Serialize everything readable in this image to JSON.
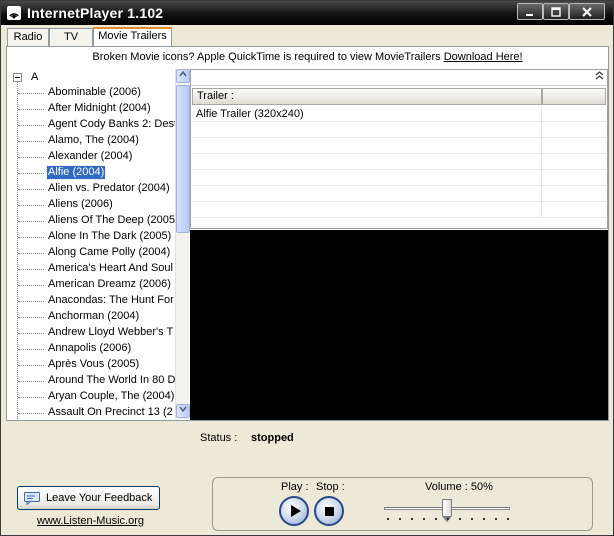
{
  "window": {
    "title": "InternetPlayer 1.102",
    "controls": [
      "minimize",
      "maximize",
      "close"
    ]
  },
  "tabs": [
    {
      "label": "Radio",
      "active": false
    },
    {
      "label": "TV",
      "active": false
    },
    {
      "label": "Movie Trailers",
      "active": true
    }
  ],
  "notice": {
    "text": "Broken Movie icons? Apple QuickTime is required to view MovieTrailers",
    "link": "Download Here!"
  },
  "tree": {
    "root": "A",
    "items": [
      "Abominable (2006)",
      "After Midnight (2004)",
      "Agent Cody Banks 2: Dest",
      "Alamo, The (2004)",
      "Alexander (2004)",
      "Alfie (2004)",
      "Alien vs. Predator (2004)",
      "Aliens (2006)",
      "Aliens Of The Deep (2005",
      "Alone In The Dark (2005)",
      "Along Came Polly (2004)",
      "America's Heart And Soul",
      "American Dreamz (2006)",
      "Anacondas: The Hunt For",
      "Anchorman (2004)",
      "Andrew Lloyd Webber's T",
      "Annapolis (2006)",
      "Après Vous (2005)",
      "Around The World In 80 D",
      "Aryan Couple, The (2004)",
      "Assault On Precinct 13 (2"
    ],
    "selected_index": 5
  },
  "grid": {
    "columns": [
      "Trailer :",
      ""
    ],
    "rows": [
      "Alfie Trailer (320x240)",
      "",
      "",
      "",
      "",
      "",
      ""
    ]
  },
  "status": {
    "label": "Status :",
    "value": "stopped"
  },
  "feedback": {
    "label": "Leave Your Feedback",
    "icon": "feedback-icon"
  },
  "site_link": "www.Listen-Music.org",
  "controls": {
    "play_label": "Play :",
    "stop_label": "Stop :",
    "volume_label": "Volume : 50%",
    "volume_level": 0.5
  }
}
